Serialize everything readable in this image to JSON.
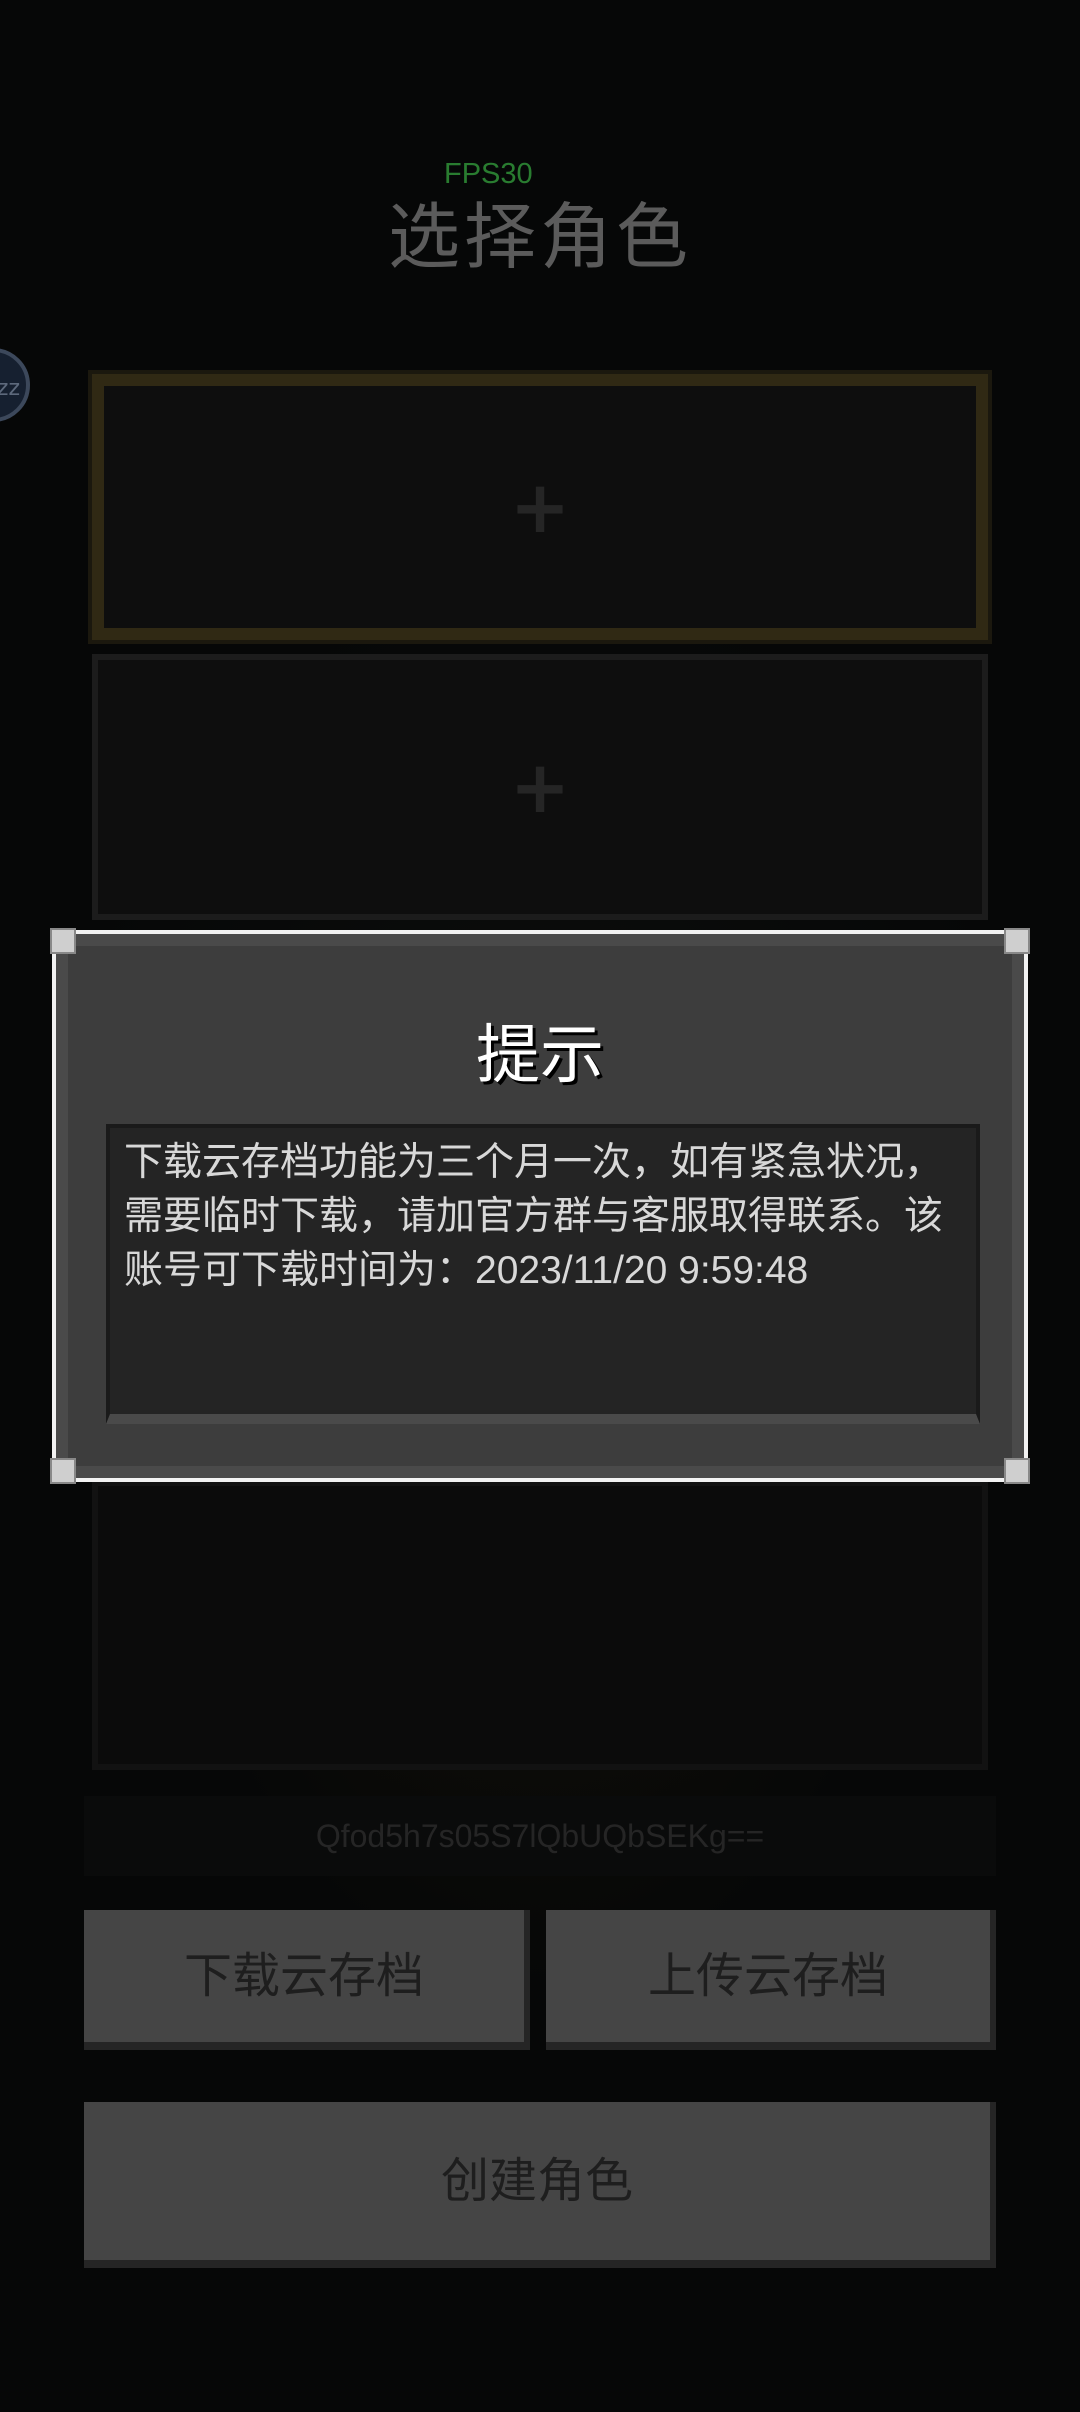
{
  "hud": {
    "fps": "FPS30"
  },
  "header": {
    "title": "选择角色"
  },
  "side_badge": {
    "label": "zz"
  },
  "slots": [
    {
      "icon": "plus-icon",
      "label": "+"
    },
    {
      "icon": "plus-icon",
      "label": "+"
    }
  ],
  "account": {
    "code": "Qfod5h7s05S7lQbUQbSEKg=="
  },
  "buttons": {
    "download": "下载云存档",
    "upload": "上传云存档",
    "create": "创建角色"
  },
  "dialog": {
    "title": "提示",
    "message": "下载云存档功能为三个月一次，如有紧急状况，需要临时下载，请加官方群与客服取得联系。该账号可下载时间为：2023/11/20 9:59:48"
  },
  "colors": {
    "fps": "#3fbf4a",
    "selected_border": "#4a4020",
    "dialog_border": "#f2f2f2"
  }
}
